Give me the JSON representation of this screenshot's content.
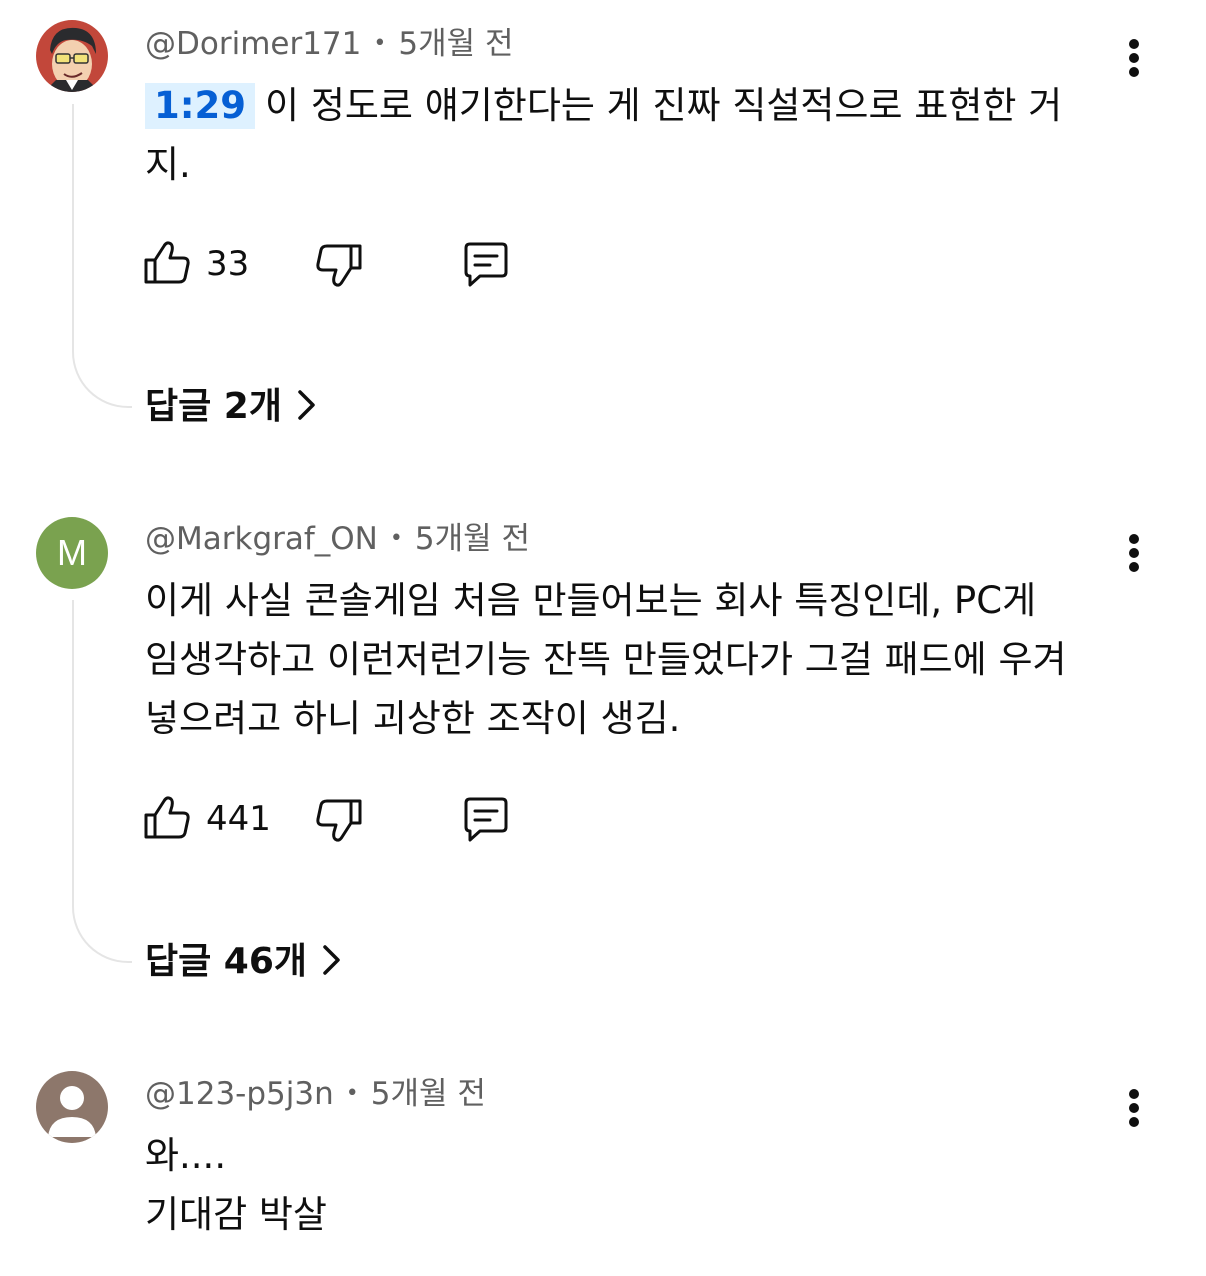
{
  "comments": [
    {
      "author": "@Dorimer171",
      "time": "5개월 전",
      "timestamp": "1:29",
      "text_line1": "이 정도로 얘기한다는 게 진짜 직설적으로 표현한 거",
      "text_line2": "지.",
      "likes": "33",
      "replies": "답글 2개",
      "avatar_icon": "illustrated-character-avatar"
    },
    {
      "author": "@Markgraf_ON",
      "time": "5개월 전",
      "avatar_letter": "M",
      "avatar_color": "#7aa24f",
      "text_line1": "이게 사실 콘솔게임 처음 만들어보는 회사 특징인데, PC게",
      "text_line2": "임생각하고 이런저런기능 잔뜩 만들었다가 그걸 패드에 우겨",
      "text_line3": "넣으려고 하니 괴상한 조작이 생김.",
      "likes": "441",
      "replies": "답글 46개"
    },
    {
      "author": "@123-p5j3n",
      "time": "5개월 전",
      "avatar_icon": "default-user-avatar",
      "avatar_color": "#8d776b",
      "text_line1": "와....",
      "text_line2": "기대감 박살"
    }
  ],
  "icons": {
    "like": "thumbs-up-icon",
    "dislike": "thumbs-down-icon",
    "reply": "comment-reply-icon",
    "more": "vertical-ellipsis-icon",
    "chevron": "chevron-right-icon"
  },
  "colors": {
    "timestamp_bg": "#def1ff",
    "timestamp_fg": "#065fd4",
    "meta": "#606060",
    "text": "#0f0f0f"
  }
}
